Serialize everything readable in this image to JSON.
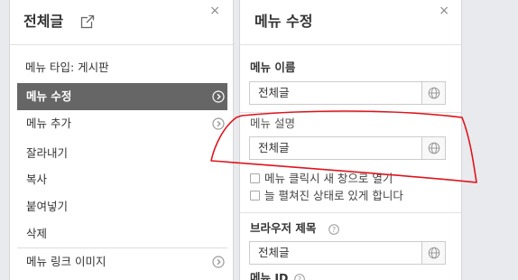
{
  "left_panel": {
    "title": "전체글",
    "close_label": "×",
    "menu_type_label": "메뉴 타입: 게시판",
    "items": [
      {
        "label": "메뉴 수정",
        "active": true,
        "arrow": true
      },
      {
        "label": "메뉴 추가",
        "active": false,
        "arrow": true
      },
      {
        "label": "잘라내기",
        "active": false,
        "arrow": false
      },
      {
        "label": "복사",
        "active": false,
        "arrow": false
      },
      {
        "label": "붙여넣기",
        "active": false,
        "arrow": false
      },
      {
        "label": "삭제",
        "active": false,
        "arrow": false
      },
      {
        "label": "메뉴 링크 이미지",
        "active": false,
        "arrow": true
      }
    ]
  },
  "right_panel": {
    "title": "메뉴 수정",
    "close_label": "×",
    "menu_name": {
      "label": "메뉴 이름",
      "value": "전체글"
    },
    "menu_desc": {
      "label": "메뉴 설명",
      "value": "전체글"
    },
    "checkboxes": [
      {
        "label": "메뉴 클릭시 새 창으로 열기",
        "checked": false
      },
      {
        "label": "늘 펼쳐진 상태로 있게 합니다",
        "checked": false
      }
    ],
    "browser_title": {
      "label": "브라우저 제목",
      "value": "전체글"
    },
    "menu_id": {
      "label": "메뉴 ID"
    }
  },
  "colors": {
    "active_item_bg": "#666666",
    "annotation_red": "#e0141c",
    "page_bg": "#e9eaed"
  }
}
